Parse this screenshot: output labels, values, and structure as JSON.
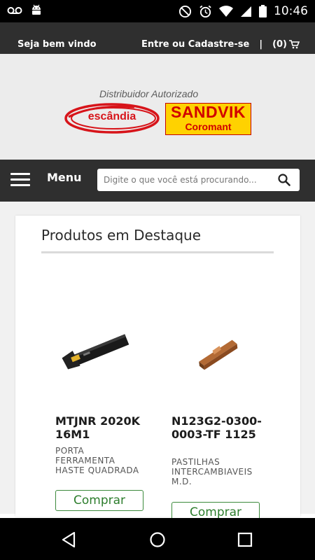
{
  "status_bar": {
    "time": "10:46",
    "icons": [
      "voicemail-icon",
      "android-icon",
      "do-not-disturb-icon",
      "alarm-icon",
      "wifi-icon",
      "signal-icon",
      "battery-icon"
    ]
  },
  "top_bar": {
    "welcome": "Seja bem vindo",
    "login_link": "Entre ou Cadastre-se",
    "separator": "|",
    "cart_count": "(0)"
  },
  "banner": {
    "distributor_text": "Distribuidor Autorizado",
    "escandia_logo_text": "escândia",
    "sandvik_line1": "SANDVIK",
    "sandvik_line2": "Coromant"
  },
  "menu_bar": {
    "menu_label": "Menu",
    "search_placeholder": "Digite o que você está procurando..."
  },
  "featured": {
    "title": "Produtos em Destaque",
    "products": [
      {
        "name": "MTJNR 2020K 16M1",
        "description": "PORTA FERRAMENTA HASTE QUADRADA",
        "buy_label": "Comprar"
      },
      {
        "name": "N123G2-0300-0003-TF 1125",
        "description": "PASTILHAS INTERCAMBIAVEIS M.D.",
        "buy_label": "Comprar"
      }
    ]
  },
  "colors": {
    "dark_bar": "#2f2f2f",
    "banner_bg": "#ececec",
    "buy_green": "#2d7d2d",
    "sandvik_yellow": "#ffd200",
    "sandvik_red": "#d10000",
    "escandia_red": "#d7141a"
  }
}
